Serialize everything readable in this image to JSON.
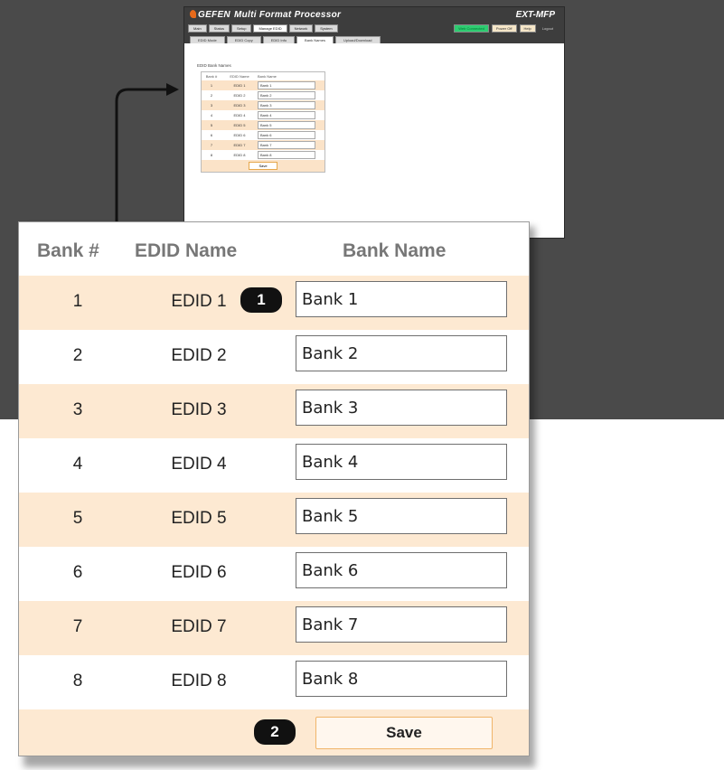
{
  "colors": {
    "backdrop": "#4a4a4a",
    "row_alt": "#fde9d2",
    "save_border": "#f0b56a",
    "badge": "#111111"
  },
  "mini": {
    "brand": "GEFEN",
    "product": "Multi Format Processor",
    "model": "EXT-MFP",
    "nav": [
      "Main",
      "Status",
      "Setup",
      "Manage EDID",
      "Network",
      "System"
    ],
    "active_nav": "Manage EDID",
    "status_connected": "Web Connected",
    "status_btn1": "Power Off",
    "status_btn2": "Help",
    "logout": "Logout",
    "tabs": [
      "EDID Mode",
      "EDID Copy",
      "EDID Info",
      "Bank Names",
      "Upload/Download"
    ],
    "active_tab": "Bank Names",
    "section_title": "EDID Bank Names",
    "table": {
      "headers": [
        "Bank #",
        "EDID Name",
        "Bank Name"
      ],
      "rows": [
        {
          "num": "1",
          "edid": "EDID 1",
          "bank": "Bank 1"
        },
        {
          "num": "2",
          "edid": "EDID 2",
          "bank": "Bank 2"
        },
        {
          "num": "3",
          "edid": "EDID 3",
          "bank": "Bank 3"
        },
        {
          "num": "4",
          "edid": "EDID 4",
          "bank": "Bank 4"
        },
        {
          "num": "5",
          "edid": "EDID 5",
          "bank": "Bank 5"
        },
        {
          "num": "6",
          "edid": "EDID 6",
          "bank": "Bank 6"
        },
        {
          "num": "7",
          "edid": "EDID 7",
          "bank": "Bank 7"
        },
        {
          "num": "8",
          "edid": "EDID 8",
          "bank": "Bank 8"
        }
      ],
      "save_label": "Save"
    }
  },
  "zoom": {
    "headers": {
      "bank_num": "Bank #",
      "edid_name": "EDID Name",
      "bank_name": "Bank Name"
    },
    "rows": [
      {
        "num": "1",
        "edid": "EDID 1",
        "bank": "Bank 1"
      },
      {
        "num": "2",
        "edid": "EDID 2",
        "bank": "Bank 2"
      },
      {
        "num": "3",
        "edid": "EDID 3",
        "bank": "Bank 3"
      },
      {
        "num": "4",
        "edid": "EDID 4",
        "bank": "Bank 4"
      },
      {
        "num": "5",
        "edid": "EDID 5",
        "bank": "Bank 5"
      },
      {
        "num": "6",
        "edid": "EDID 6",
        "bank": "Bank 6"
      },
      {
        "num": "7",
        "edid": "EDID 7",
        "bank": "Bank 7"
      },
      {
        "num": "8",
        "edid": "EDID 8",
        "bank": "Bank 8"
      }
    ],
    "badge1": "1",
    "badge2": "2",
    "save_label": "Save"
  }
}
